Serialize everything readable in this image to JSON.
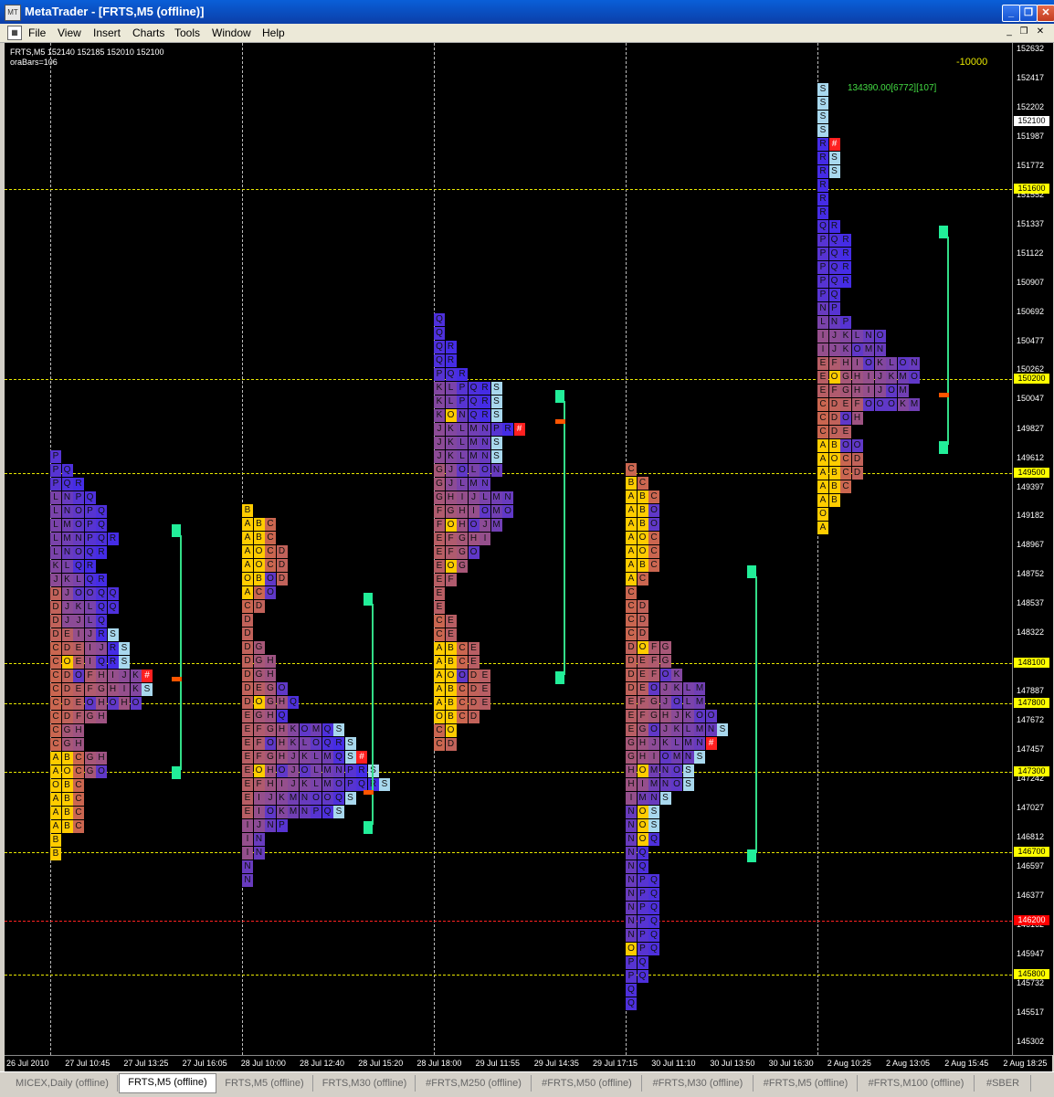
{
  "window": {
    "title": "MetaTrader - [FRTS,M5 (offline)]",
    "minimize": "_",
    "restore": "❐",
    "close": "✕"
  },
  "menu": [
    "File",
    "View",
    "Insert",
    "Charts",
    "Tools",
    "Window",
    "Help"
  ],
  "chart": {
    "header_line1": "FRTS,M5  152140 152185 152010 152100",
    "header_line2": "oraBars=106",
    "top_right_value": "-10000",
    "profile_stat": "134390.00[6772][107]"
  },
  "price_axis": [
    "152632",
    "152417",
    "152202",
    "151987",
    "151772",
    "151552",
    "151337",
    "151122",
    "150907",
    "150692",
    "150477",
    "150262",
    "150047",
    "149827",
    "149612",
    "149397",
    "149182",
    "148967",
    "148752",
    "148537",
    "148322",
    "147887",
    "147672",
    "147457",
    "147242",
    "147027",
    "146812",
    "146597",
    "146377",
    "146162",
    "145947",
    "145732",
    "145517",
    "145302"
  ],
  "price_tags": [
    {
      "value": "152100",
      "bg": "#ffffff",
      "fg": "#000000"
    },
    {
      "value": "151600",
      "bg": "#ffff00",
      "fg": "#000000"
    },
    {
      "value": "150200",
      "bg": "#ffff00",
      "fg": "#000000"
    },
    {
      "value": "149500",
      "bg": "#ffff00",
      "fg": "#000000"
    },
    {
      "value": "148100",
      "bg": "#ffff00",
      "fg": "#000000"
    },
    {
      "value": "147800",
      "bg": "#ffff00",
      "fg": "#000000"
    },
    {
      "value": "147300",
      "bg": "#ffff00",
      "fg": "#000000"
    },
    {
      "value": "146700",
      "bg": "#ffff00",
      "fg": "#000000"
    },
    {
      "value": "146200",
      "bg": "#ff0000",
      "fg": "#ffffff"
    },
    {
      "value": "145800",
      "bg": "#ffff00",
      "fg": "#000000"
    }
  ],
  "time_axis": [
    "26 Jul 2010",
    "27 Jul 10:45",
    "27 Jul 13:25",
    "27 Jul 16:05",
    "28 Jul 10:00",
    "28 Jul 12:40",
    "28 Jul 15:20",
    "28 Jul 18:00",
    "29 Jul 11:55",
    "29 Jul 14:35",
    "29 Jul 17:15",
    "30 Jul 11:10",
    "30 Jul 13:50",
    "30 Jul 16:30",
    "2 Aug 10:25",
    "2 Aug 13:05",
    "2 Aug 15:45",
    "2 Aug 18:25"
  ],
  "tabs": [
    "MICEX,Daily (offline)",
    "FRTS,M5 (offline)",
    "FRTS,M5 (offline)",
    "FRTS,M30 (offline)",
    "#FRTS,M250 (offline)",
    "#FRTS,M50 (offline)",
    "#FRTS,M30 (offline)",
    "#FRTS,M5 (offline)",
    "#FRTS,M100 (offline)",
    "#SBER"
  ],
  "active_tab": 1,
  "profiles": [
    {
      "rows": [
        "P",
        "PQ",
        "PQR",
        "LNPQ",
        "LNOPQ",
        "LMOPQ",
        "LMNPQR",
        "LNOQR",
        "KLQR",
        "JKLQR",
        "DJOOQQ",
        "DJKLQQ",
        "DJJLQ",
        "DEIJRS",
        "CDEIJRS",
        "COEIQRS",
        "CDOFHIJK#",
        "CDEFGHIKS",
        "CDEOHOHO",
        "CDFGH",
        "CGH",
        "CGH",
        "ABCGH",
        "AOCGO",
        "OBC",
        "ABC",
        "ABC",
        "ABC",
        "B",
        "B"
      ]
    },
    {
      "rows": [
        "B",
        "ABC",
        "ABC",
        "AOCD",
        "AOCD",
        "OBOD",
        "ACO",
        "CD",
        "D",
        "D",
        "DG",
        "DGH",
        "DGH",
        "DEGO",
        "DOGHQ",
        "EGHQ",
        "EFGHKOMQS",
        "EFOHKLOQRS",
        "EFGHJKLMQS#",
        "EOHOJOLMNPRS",
        "EFHIJKLMOPQRS",
        "EIJKMNOOQS",
        "EIOKMNPQS",
        "IJNP",
        "IN",
        "IN",
        "N",
        "N"
      ]
    },
    {
      "rows": [
        "Q",
        "Q",
        "QR",
        "QR",
        "PQR",
        "KLPQRS",
        "KLPQRS",
        "KONQRS",
        "JKLMNPR#",
        "JKLMNS",
        "JKLMNS",
        "GJOLON",
        "GJLMN",
        "GHIJLMN",
        "FGHIOMO",
        "FOHOJM",
        "EFGHI",
        "EFGO",
        "EOG",
        "EF",
        "E",
        "E",
        "CE",
        "CE",
        "ABCE",
        "ABCE",
        "AOODE",
        "ABCDE",
        "ABCDE",
        "OBCD",
        "CO",
        "CD"
      ]
    },
    {
      "rows": [
        "C",
        "BC",
        "ABC",
        "ABO",
        "ABO",
        "AOC",
        "AOC",
        "ABC",
        "AC",
        "C",
        "CD",
        "CD",
        "CD",
        "DOFG",
        "DEFG",
        "DEFOK",
        "DEOJKLM",
        "EFGJOLM",
        "EFGHJKOO",
        "EGOJKLMNS",
        "GHJKLMN#",
        "GHIOMNS",
        "HOMNOS",
        "HIMNOS",
        "IMNS",
        "NOS",
        "NOS",
        "NOQ",
        "NQ",
        "NQ",
        "NPQ",
        "NPQ",
        "NPQ",
        "NPQ",
        "NPQ",
        "OPQ",
        "PQ",
        "PQ",
        "Q",
        "Q"
      ]
    },
    {
      "rows": [
        "S",
        "S",
        "S",
        "S",
        "R#",
        "RS",
        "RS",
        "R",
        "R",
        "R",
        "QR",
        "PQR",
        "PQR",
        "PQR",
        "PQR",
        "PQ",
        "NP",
        "LNP",
        "IJKLNO",
        "IJKOMN",
        "EFHIOKLON",
        "EOGHIJKMO",
        "EFGHIJOM",
        "CDEFOOOKM",
        "CDOH",
        "CDE",
        "ABOO",
        "AOCD",
        "ABCD",
        "ABC",
        "AB",
        "O",
        "A"
      ]
    }
  ]
}
